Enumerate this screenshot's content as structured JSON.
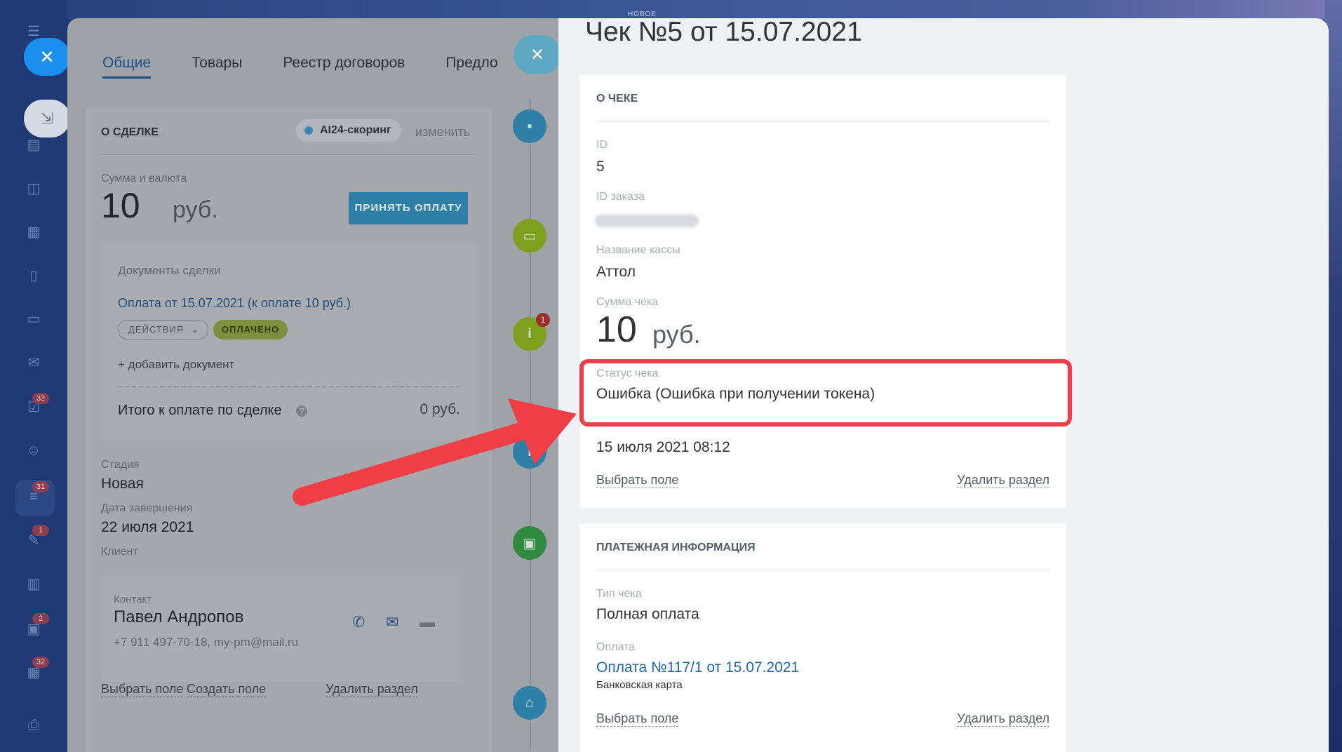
{
  "screen": {
    "new_tag": "НОВОЕ"
  },
  "sidebar": {
    "badges": [
      "32",
      "31",
      "1",
      "2",
      "32"
    ]
  },
  "deal": {
    "tabs": [
      {
        "label": "Общие",
        "active": true
      },
      {
        "label": "Товары",
        "active": false
      },
      {
        "label": "Реестр договоров",
        "active": false
      },
      {
        "label": "Предло",
        "active": false
      }
    ],
    "section_title": "О СДЕЛКЕ",
    "scoring_label": "AI24-скоринг",
    "edit_label": "изменить",
    "amount_label": "Сумма и валюта",
    "amount_value": "10",
    "amount_currency": "руб.",
    "accept_button": "ПРИНЯТЬ ОПЛАТУ",
    "documents": {
      "title": "Документы сделки",
      "payment_link": "Оплата от 15.07.2021 (к оплате 10 руб.)",
      "actions_label": "ДЕЙСТВИЯ",
      "paid_badge": "ОПЛАЧЕНО",
      "add_document": "+ добавить документ",
      "total_label": "Итого к оплате по сделке",
      "total_value": "0 руб."
    },
    "stage_label": "Стадия",
    "stage_value": "Новая",
    "end_date_label": "Дата завершения",
    "end_date_value": "22 июля 2021",
    "client_label": "Клиент",
    "contact": {
      "label": "Контакт",
      "name": "Павел Андропов",
      "details": "+7 911 497-70-18, my-pm@mail.ru"
    },
    "footer": {
      "choose_field": "Выбрать поле",
      "create_field": "Создать поле",
      "delete_section": "Удалить раздел"
    }
  },
  "timeline": {
    "info_badge": "1",
    "colors": {
      "chat": "#2f7fa6",
      "comment": "#7f9f1f",
      "info": "#7f9f1f",
      "wallet": "#2f8a3f",
      "basket": "#2f7fa6"
    }
  },
  "receipt": {
    "title": "Чек №5 от 15.07.2021",
    "about": {
      "section_title": "О ЧЕКЕ",
      "id_label": "ID",
      "id_value": "5",
      "order_id_label": "ID заказа",
      "register_label": "Название кассы",
      "register_value": "Аттол",
      "sum_label": "Сумма чека",
      "sum_value": "10",
      "sum_currency": "руб.",
      "status_label": "Статус чека",
      "status_value": "Ошибка (Ошибка при получении токена)",
      "date_value": "15 июля 2021 08:12",
      "choose_field": "Выбрать поле",
      "delete_section": "Удалить раздел"
    },
    "payment": {
      "section_title": "ПЛАТЕЖНАЯ ИНФОРМАЦИЯ",
      "type_label": "Тип чека",
      "type_value": "Полная оплата",
      "payment_label": "Оплата",
      "payment_link": "Оплата №117/1 от 15.07.2021",
      "payment_method": "Банковская карта",
      "choose_field": "Выбрать поле",
      "delete_section": "Удалить раздел"
    }
  },
  "annotation_color": "#ef3e45"
}
